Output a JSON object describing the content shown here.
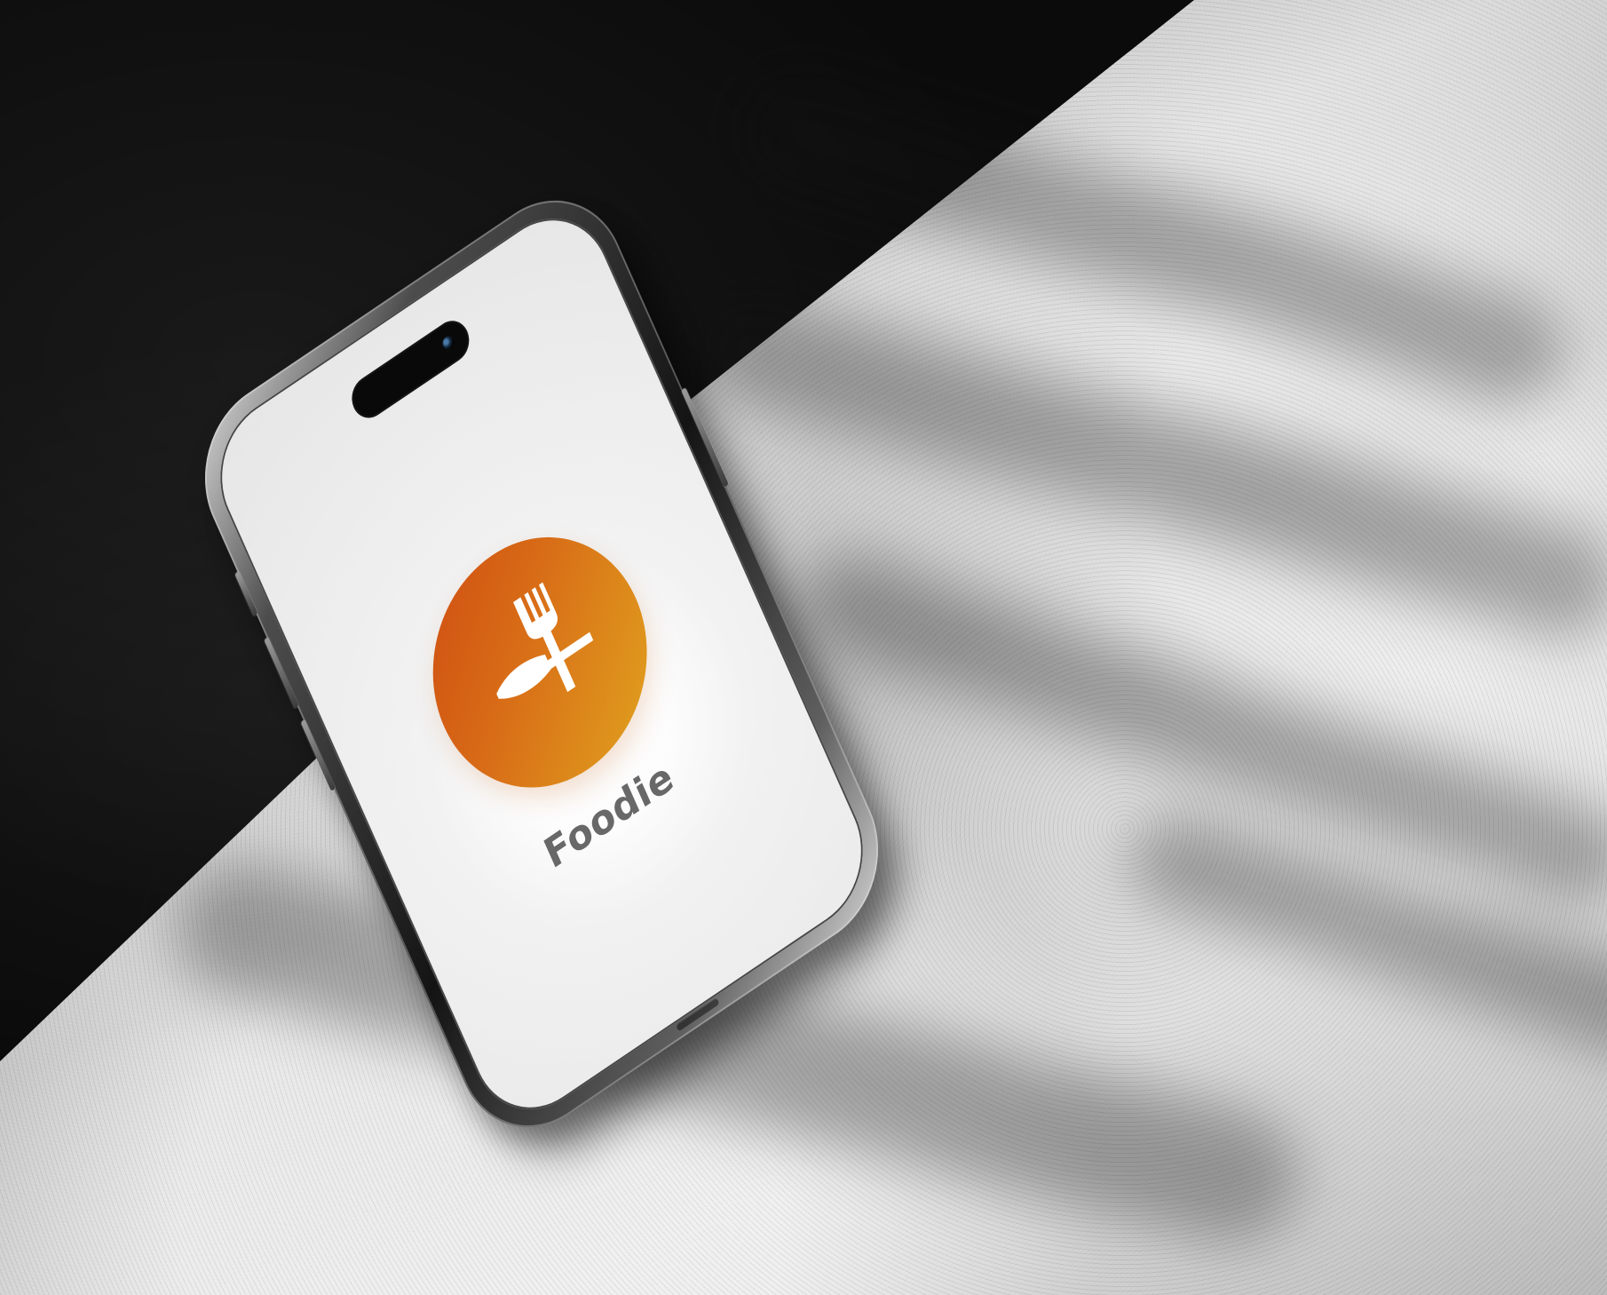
{
  "app": {
    "name": "Foodie"
  },
  "icons": {
    "brand_logo": "knife-fork-icon"
  },
  "colors": {
    "logo_start": "#cf4c11",
    "logo_end": "#e1a61f",
    "screen_bg": "#e8e8e8",
    "brand_text": "#686868"
  }
}
